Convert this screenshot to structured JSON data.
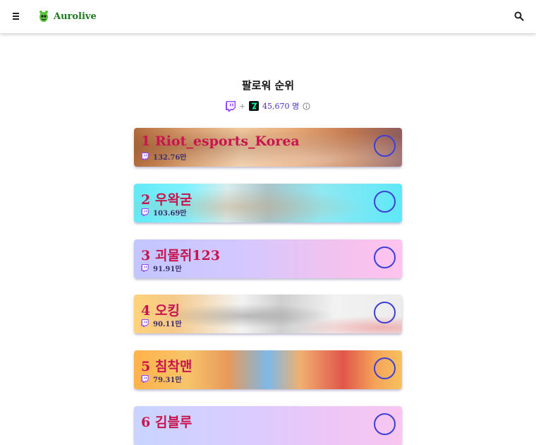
{
  "header": {
    "brand": "Aurolive",
    "menu_icon": "hamburger-menu-icon",
    "search_icon": "search-icon"
  },
  "page": {
    "title": "팔로워 순위",
    "platform_plus": "+",
    "total_count": "45,670 명"
  },
  "ranking": [
    {
      "rank": "1",
      "name": "Riot_esports_Korea",
      "followers": "132.76만"
    },
    {
      "rank": "2",
      "name": "우왁굳",
      "followers": "103.69만"
    },
    {
      "rank": "3",
      "name": "괴물쥐123",
      "followers": "91.91만"
    },
    {
      "rank": "4",
      "name": "오킹",
      "followers": "90.11만"
    },
    {
      "rank": "5",
      "name": "침착맨",
      "followers": "79.31만"
    },
    {
      "rank": "6",
      "name": "김블루",
      "followers": ""
    }
  ],
  "colors": {
    "accent_purple": "#9146ff",
    "name_red": "#c8154f",
    "ring_blue": "#3f3fd8"
  }
}
